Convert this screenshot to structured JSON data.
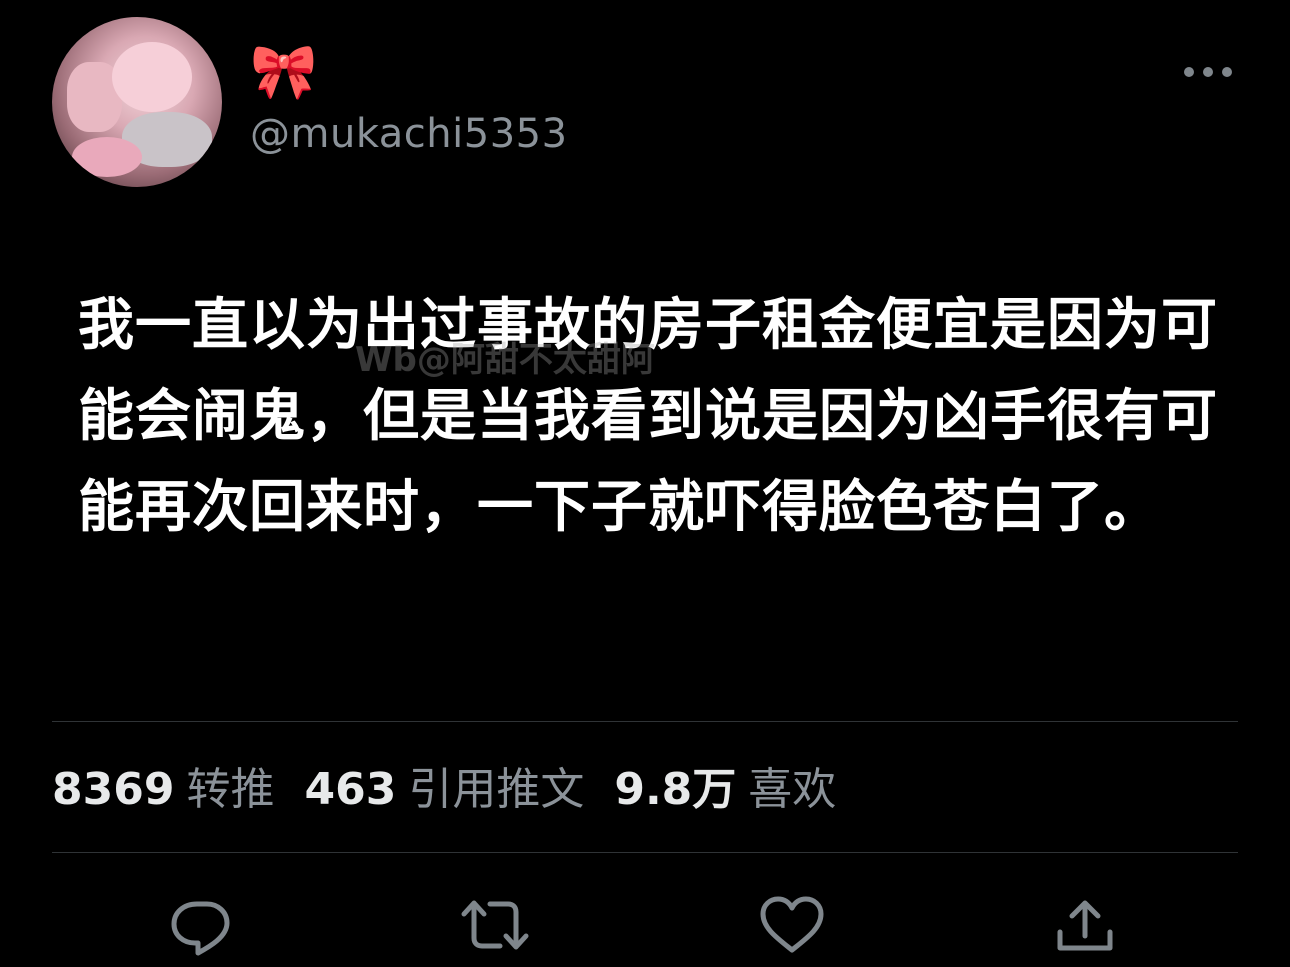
{
  "author": {
    "display_name": "🎀",
    "handle": "@mukachi5353"
  },
  "tweet": {
    "text": "我一直以为出过事故的房子租金便宜是因为可能会闹鬼，但是当我看到说是因为凶手很有可能再次回来时，一下子就吓得脸色苍白了。",
    "watermark": "Wb@阿甜不太甜阿"
  },
  "stats": {
    "retweets_count": "8369",
    "retweets_label": "转推",
    "quotes_count": "463",
    "quotes_label": "引用推文",
    "likes_count": "9.8万",
    "likes_label": "喜欢"
  },
  "icons": {
    "more": "more-dots-icon",
    "reply": "reply-bubble-icon",
    "retweet": "retweet-arrows-icon",
    "like": "heart-icon",
    "share": "share-upload-icon"
  },
  "colors": {
    "background": "#000000",
    "text_primary": "#ffffff",
    "text_secondary": "#8b9299",
    "icon": "#7f868c",
    "divider": "#2f3336"
  }
}
